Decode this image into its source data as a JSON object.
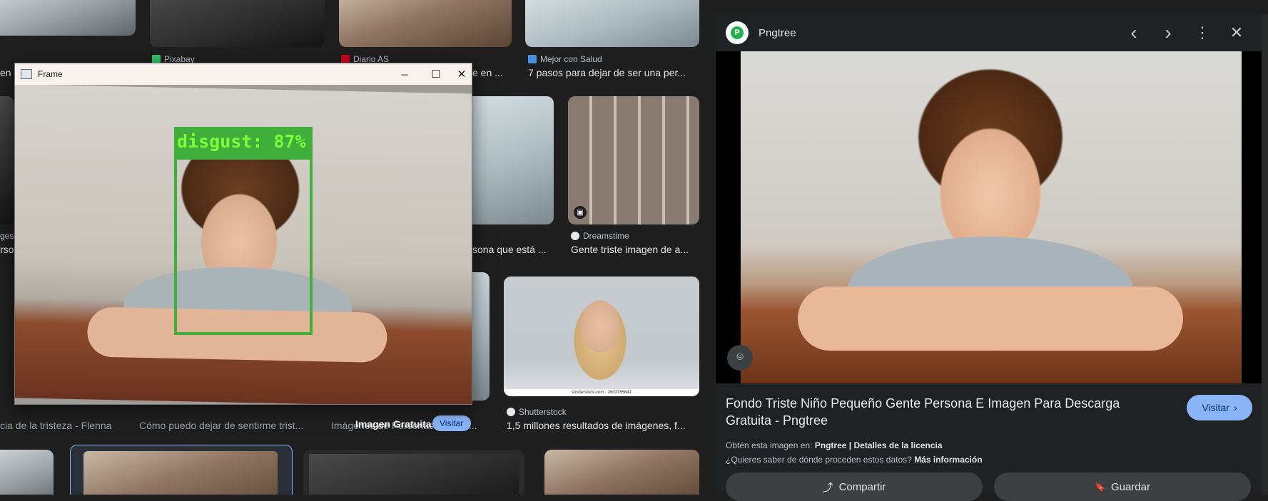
{
  "results": {
    "row1": [
      {
        "source": "Pixabay",
        "caption": ""
      },
      {
        "source": "Diario AS",
        "caption": "e en ..."
      },
      {
        "source": "Mejor con Salud",
        "caption": "7 pasos para dejar de ser una per..."
      }
    ],
    "row1_left_caption_fragment": "en",
    "row2": [
      {
        "source": "",
        "caption": "sona que está ..."
      },
      {
        "source": "Dreamstime",
        "caption": "Gente triste imagen de a..."
      }
    ],
    "row2_left_fragments": [
      "ges",
      "rso"
    ],
    "row3": [
      {
        "source": "",
        "caption": "cia de la tristeza - Flenna"
      },
      {
        "source": "",
        "caption": "Cómo puedo dejar de sentirme trist..."
      },
      {
        "source": "",
        "caption": "Imágenes de Personas Tristes ..."
      },
      {
        "source": "Shutterstock",
        "caption": "1,5 millones resultados de imágenes, f..."
      }
    ],
    "shutterstock_watermark": "shutterstock.com · 2603765641",
    "partial_overlay_text": "Imagen Gratuita -",
    "partial_visit_text": "Visitar"
  },
  "frame_window": {
    "title": "Frame",
    "minimize": "─",
    "maximize": "☐",
    "close": "✕",
    "detection_label": "disgust: 87%"
  },
  "panel": {
    "site_name": "Pngtree",
    "logo_letter": "P",
    "title": "Fondo Triste Niño Pequeño Gente Persona E Imagen Para Descarga Gratuita - Pngtree",
    "visit_label": "Visitar",
    "visit_arrow": "›",
    "meta1_prefix": "Obtén esta imagen en:",
    "meta1_site": "Pngtree",
    "meta1_sep": "|",
    "meta1_license": "Detalles de la licencia",
    "meta2_prefix": "¿Quieres saber de dónde proceden estos datos?",
    "meta2_link": "Más información",
    "share_label": "Compartir",
    "save_label": "Guardar",
    "icons": {
      "prev": "‹",
      "next": "›",
      "more": "⋮",
      "close": "✕",
      "lens": "⌾",
      "share": "⤴",
      "save": "🔖"
    }
  },
  "colors": {
    "accent": "#8ab4f8",
    "detect_green": "#3fae3a",
    "label_green": "#7cff3a"
  }
}
